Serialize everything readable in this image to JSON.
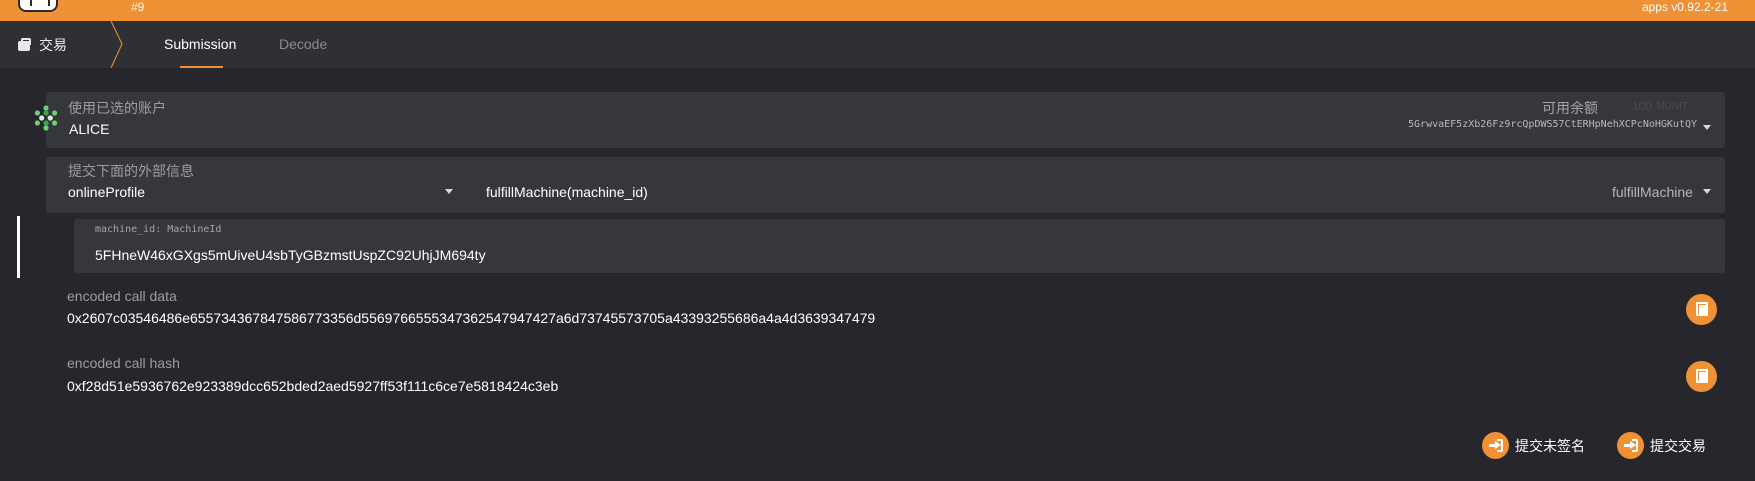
{
  "topbar": {
    "chain_number": "#9",
    "version": "apps v0.92.2-21",
    "accent_color": "#f19135"
  },
  "nav": {
    "section_icon": "transfer-icon",
    "section_label": "交易",
    "tabs": [
      {
        "label": "Submission",
        "active": true
      },
      {
        "label": "Decode",
        "active": false
      }
    ]
  },
  "account": {
    "label": "使用已选的账户",
    "name": "ALICE",
    "balance_label": "可用余额",
    "balance_value": "100",
    "balance_unit": "MUNIT",
    "address": "5GrwvaEF5zXb26Fz9rcQpDWS57CtERHpNehXCPcNoHGKutQY"
  },
  "extrinsic": {
    "label": "提交下面的外部信息",
    "pallet": "onlineProfile",
    "call_signature": "fulfillMachine(machine_id)",
    "call_name": "fulfillMachine"
  },
  "param": {
    "label": "machine_id: MachineId",
    "value": "5FHneW46xGXgs5mUiveU4sbTyGBzmstUspZC92UhjJM694ty"
  },
  "encoded": {
    "data_label": "encoded call data",
    "data_value": "0x2607c03546486e65573436784758677335 6d556976655534736254794742 7a6d73745573705a43393255686a4a4d3639347479",
    "hash_label": "encoded call hash",
    "hash_value": "0xf28d51e5936762e923389dcc652bded2aed5927ff53f111c6ce7e5818424c3eb"
  },
  "actions": {
    "unsigned_label": "提交未签名",
    "submit_label": "提交交易"
  }
}
